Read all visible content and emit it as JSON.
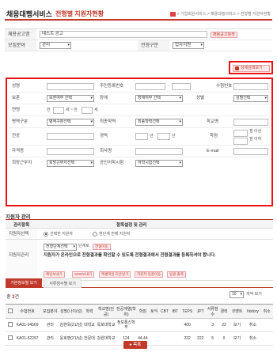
{
  "header": {
    "title": "채용대행서비스",
    "subtitle": "전형별 지원자현황",
    "breadcrumb": "> 기업회원서비스 > 채용대행서비스 > 전형별 지원자현황"
  },
  "topform": {
    "notice_label": "채용공고명",
    "notice_value": "테스트 공고",
    "notice_button": "채용공고검색",
    "field_label": "모집분야",
    "field_value": "관리",
    "stage_label": "전형구분",
    "stage_value": "입사지원"
  },
  "detail_toggle": "상세검색보기",
  "search": {
    "name": "성명",
    "rrn": "주민등록번호",
    "rrn_dash": "-",
    "exam_no": "수험번호",
    "veteran": "보훈",
    "veteran_sel": "보훈여부 선택",
    "disability": "장애",
    "disability_sel": "장애여부 선택",
    "gender": "성별",
    "gender_sel": "성별선택",
    "age": "연령",
    "age_from": "만",
    "age_mid": "세 ~ 만",
    "age_to": "세",
    "military": "병역구분",
    "military_sel": "병역구분선택",
    "education": "최종학력",
    "education_sel": "최종학력선택",
    "school": "학교명",
    "major": "전공",
    "career": "경력",
    "career_from": "년",
    "career_to": "년",
    "credit": "학점",
    "credit_up": "점 이상",
    "credit_down": "점 이하",
    "license": "자격증",
    "company": "회사명",
    "email": "E-mail",
    "job": "희망근무지",
    "job_sel": "희망근무지선택",
    "lang": "공인어학시험",
    "lang_sel": "어학시험선택"
  },
  "manage": {
    "title": "지원자 관리",
    "col1": "관리항목",
    "col2": "항목설정 및 관리",
    "select_label": "지원자선택",
    "radio1": "선택한 지원자",
    "radio2": "현단계 전체 지원자",
    "manage_label": "지원자관리",
    "stage_sel": "전형단계선택",
    "stage_text": "단계로",
    "move_btn": "전형이동",
    "desc": "지원자가 온라인으로 전형결과를 확인할 수 있도록 전형결과에서 전형결과를 등록하셔야 합니다.",
    "btn1": "메일보내기",
    "btn2": "SMS보내기",
    "btn3": "엑셀파일 다운받기",
    "btn4": "지원자 일괄이동",
    "btn5": "일괄 출력"
  },
  "tabs": {
    "tab1": "기본정보별 보기",
    "tab2": "서류점수별 보기"
  },
  "list": {
    "total_prefix": "총",
    "total_count": "2",
    "total_suffix": "건",
    "per_page": "10",
    "per_page_suffix": "개씩 보기",
    "headers": [
      "수험번호",
      "모집분야",
      "성명(나이/성)",
      "학력",
      "학교명(전공)",
      "전공계열(학위)",
      "학점",
      "토익",
      "CBT",
      "IBT",
      "TEPS",
      "JPT",
      "서류점수",
      "경력",
      "코멘트",
      "history",
      "취소"
    ],
    "rows": [
      [
        "KA01-04569",
        "관리",
        "김현욱(21/남)",
        "대학교",
        "목포대학교",
        "정보통신학부",
        "",
        "",
        "",
        "",
        "400",
        "",
        "3",
        "22",
        "보기",
        "취소"
      ],
      [
        "KA01-52297",
        "관리",
        "윤호영(21/남)",
        "전문대",
        "강원대학교",
        "124",
        "44.44",
        "",
        "",
        "",
        "222",
        "222",
        "5",
        "0",
        "보기",
        "취소"
      ]
    ]
  },
  "list_button": "목록"
}
